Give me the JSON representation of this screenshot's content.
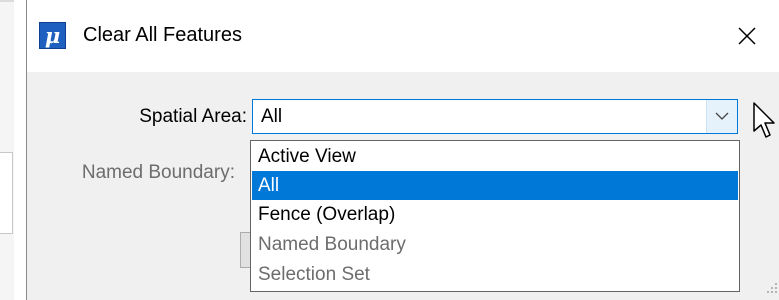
{
  "dialog": {
    "title": "Clear All Features",
    "icon": "microstation-mu-icon",
    "accent_color": "#0078d7"
  },
  "fields": {
    "spatial_area_label": "Spatial Area:",
    "spatial_area_value": "All",
    "named_boundary_label": "Named Boundary:"
  },
  "dropdown": {
    "options": [
      {
        "label": "Active View",
        "state": "normal"
      },
      {
        "label": "All",
        "state": "selected"
      },
      {
        "label": "Fence (Overlap)",
        "state": "normal"
      },
      {
        "label": "Named Boundary",
        "state": "disabled"
      },
      {
        "label": "Selection Set",
        "state": "disabled"
      }
    ]
  }
}
